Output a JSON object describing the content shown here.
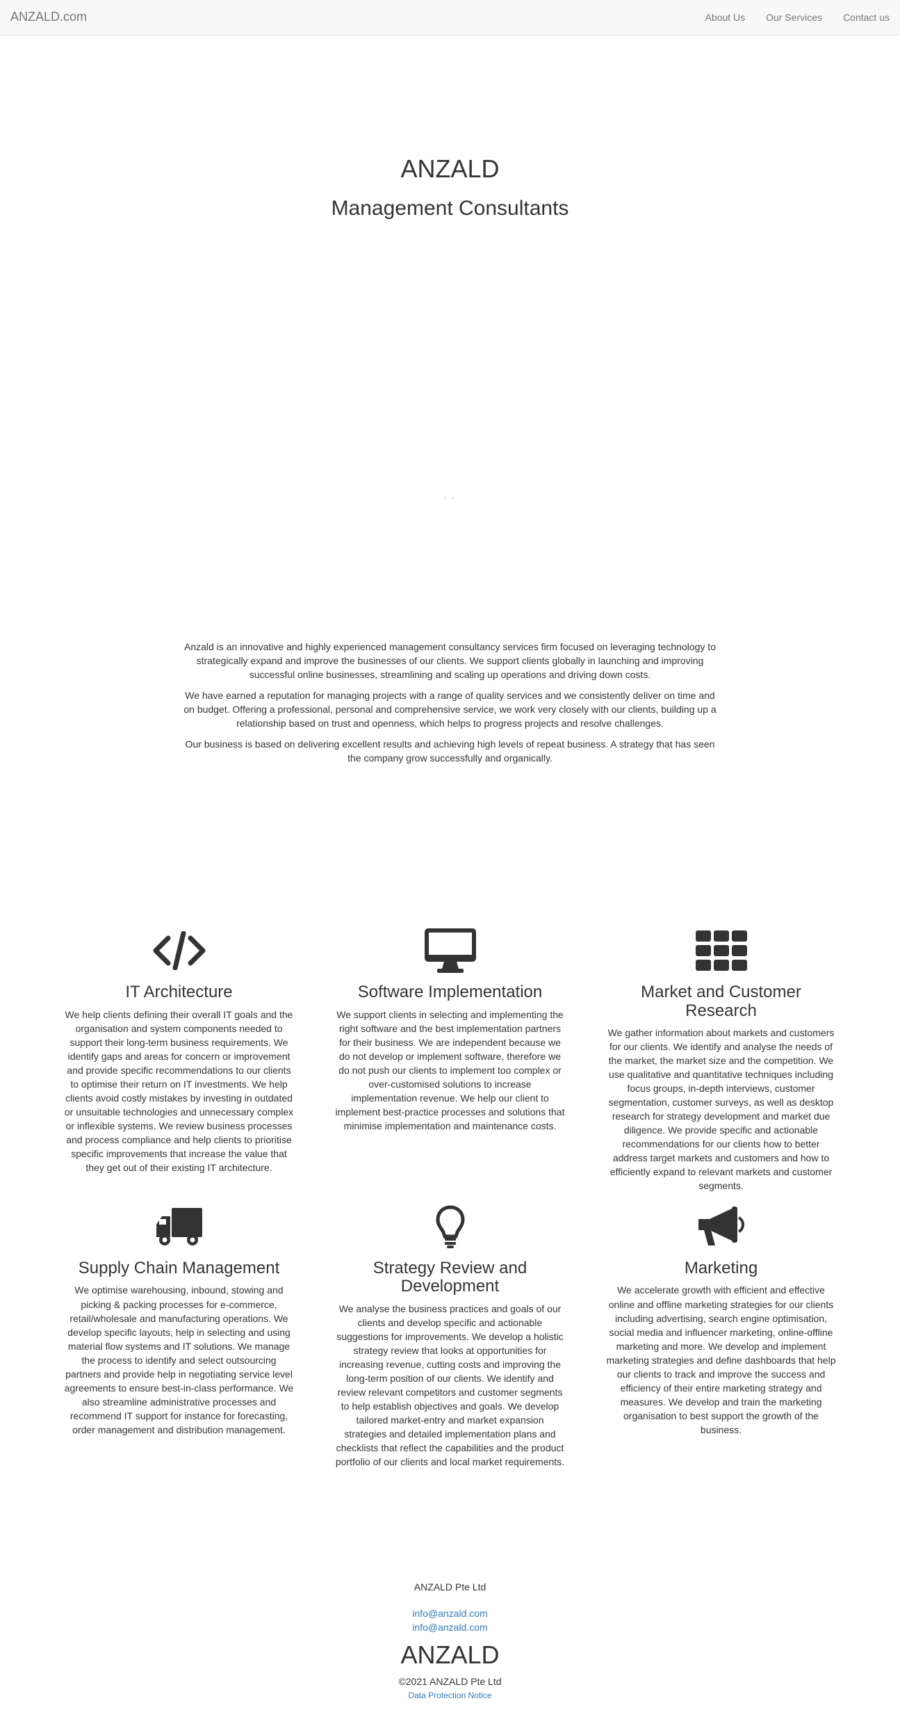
{
  "navbar": {
    "brand": "ANZALD.com",
    "links": [
      "About Us",
      "Our Services",
      "Contact us"
    ]
  },
  "hero": {
    "title": "ANZALD",
    "subtitle": "Management Consultants",
    "dots": "• •"
  },
  "intro": {
    "paragraphs": [
      "Anzald is an innovative and highly experienced management consultancy services firm focused on leveraging technology to strategically expand and improve the businesses of our clients. We support clients globally in launching and improving successful online businesses, streamlining and scaling up operations and driving down costs.",
      "We have earned a reputation for managing projects with a range of quality services and we consistently deliver on time and on budget. Offering a professional, personal and comprehensive service, we work very closely with our clients, building up a relationship based on trust and openness, which helps to progress projects and resolve challenges.",
      "Our business is based on delivering excellent results and achieving high levels of repeat business. A strategy that has seen the company grow successfully and organically."
    ]
  },
  "services": [
    {
      "icon": "code-icon",
      "title": "IT Architecture",
      "text": "We help clients defining their overall IT goals and the organisation and system components needed to support their long-term business requirements. We identify gaps and areas for concern or improvement and provide specific recommendations to our clients to optimise their return on IT investments. We help clients avoid costly mistakes by investing in outdated or unsuitable technologies and unnecessary complex or inflexible systems. We review business processes and process compliance and help clients to prioritise specific improvements that increase the value that they get out of their existing IT architecture."
    },
    {
      "icon": "desktop-icon",
      "title": "Software Implementation",
      "text": "We support clients in selecting and implementing the right software and the best implementation partners for their business. We are independent because we do not develop or implement software, therefore we do not push our clients to implement too complex or over-customised solutions to increase implementation revenue. We help our client to implement best-practice processes and solutions that minimise implementation and maintenance costs."
    },
    {
      "icon": "th-icon",
      "title": "Market and Customer Research",
      "text": "We gather information about markets and customers for our clients. We identify and analyse the needs of the market, the market size and the competition. We use qualitative and quantitative techniques including focus groups, in-depth interviews, customer segmentation, customer surveys, as well as desktop research for strategy development and market due diligence. We provide specific and actionable recommendations for our clients how to better address target markets and customers and how to efficiently expand to relevant markets and customer segments."
    },
    {
      "icon": "truck-icon",
      "title": "Supply Chain Management",
      "text": "We optimise warehousing, inbound, stowing and picking & packing processes for e-commerce, retail/wholesale and manufacturing operations. We develop specific layouts, help in selecting and using material flow systems and IT solutions. We manage the process to identify and select outsourcing partners and provide help in negotiating service level agreements to ensure best-in-class performance. We also streamline administrative processes and recommend IT support for instance for forecasting, order management and distribution management."
    },
    {
      "icon": "lightbulb-icon",
      "title": "Strategy Review and Development",
      "text": "We analyse the business practices and goals of our clients and develop specific and actionable suggestions for improvements. We develop a holistic strategy review that looks at opportunities for increasing revenue, cutting costs and improving the long-term position of our clients. We identify and review relevant competitors and customer segments to help establish objectives and goals. We develop tailored market-entry and market expansion strategies and detailed implementation plans and checklists that reflect the capabilities and the product portfolio of our clients and local market requirements."
    },
    {
      "icon": "bullhorn-icon",
      "title": "Marketing",
      "text": "We accelerate growth with efficient and effective online and offline marketing strategies for our clients including advertising, search engine optimisation, social media and influencer marketing, online-offline marketing and more. We develop and implement marketing strategies and define dashboards that help our clients to track and improve the success and efficiency of their entire marketing strategy and measures. We develop and train the marketing organisation to best support the growth of the business."
    }
  ],
  "footer": {
    "company": "ANZALD Pte Ltd",
    "emails": [
      "info@anzald.com",
      "info@anzald.com"
    ],
    "logo": "ANZALD",
    "copyright": "©2021 ANZALD Pte Ltd",
    "data_protection": "Data Protection Notice"
  },
  "colors": {
    "text": "#333333",
    "navbar_bg": "#f8f8f8",
    "nav_link": "#777777",
    "link": "#337ab7"
  }
}
